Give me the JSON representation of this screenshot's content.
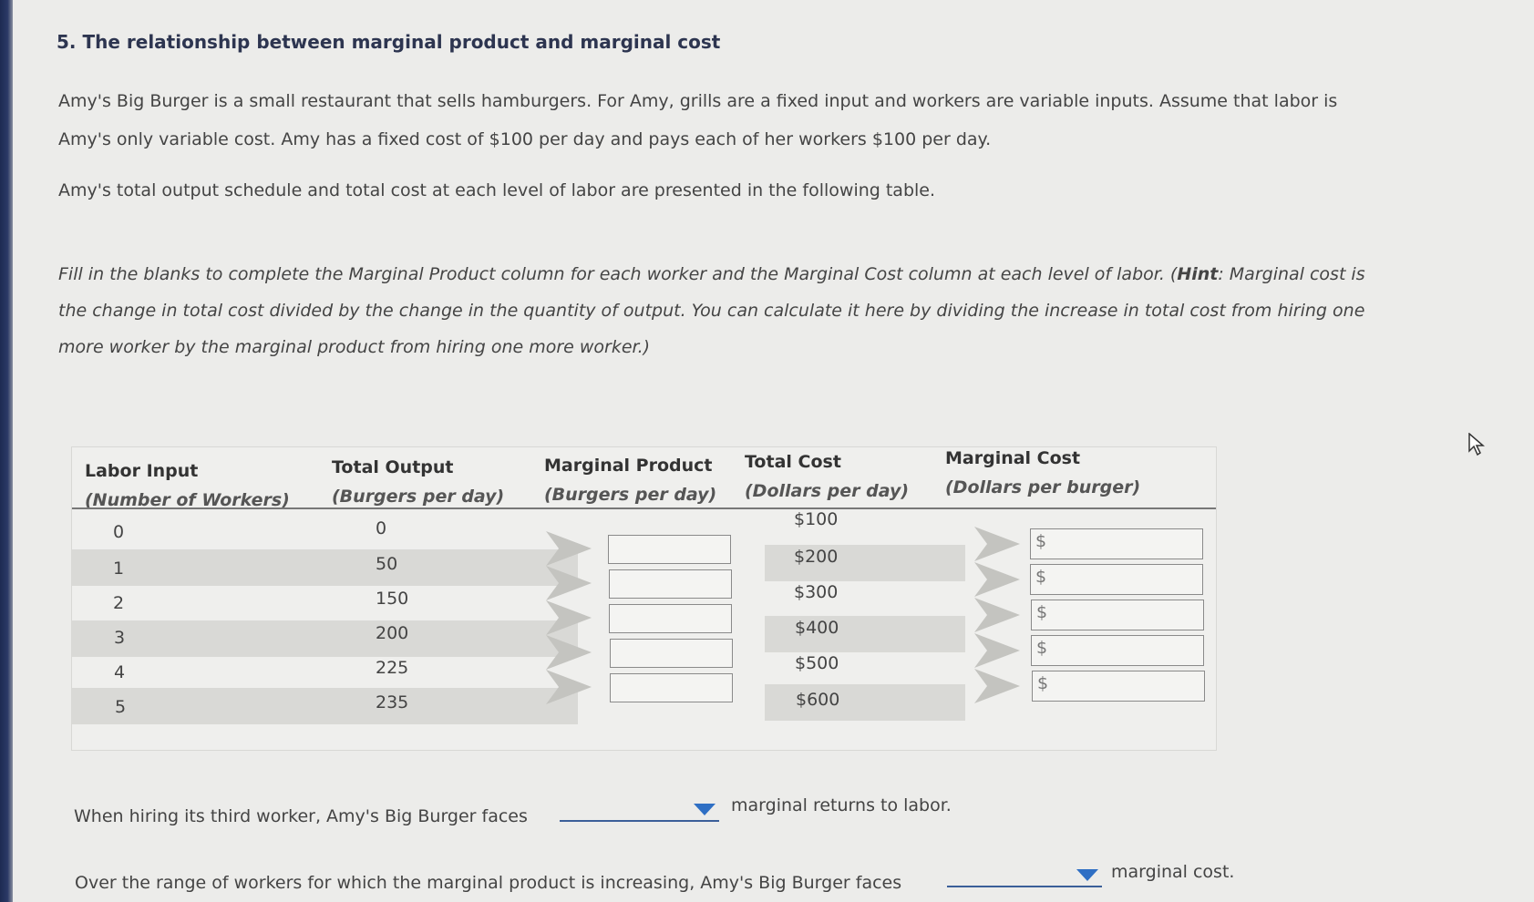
{
  "question": {
    "title": "5. The relationship between marginal product and marginal cost",
    "intro_line1": "Amy's Big Burger is a small restaurant that sells hamburgers. For Amy, grills are a fixed input and workers are variable inputs. Assume that labor is",
    "intro_line2": "Amy's only variable cost. Amy has a fixed cost of $100 per day and pays each of her workers $100 per day.",
    "intro_line3": "Amy's total output schedule and total cost at each level of labor are presented in the following table.",
    "instr_line1_a": "Fill in the blanks to complete the Marginal Product column for each worker and the Marginal Cost column at each level of labor. (",
    "instr_hint": "Hint",
    "instr_line1_b": ": Marginal cost is",
    "instr_line2": "the change in total cost divided by the change in the quantity of output. You can calculate it here by dividing the increase in total cost from hiring one",
    "instr_line3": "more worker by the marginal product from hiring one more worker.)"
  },
  "table": {
    "headers": [
      {
        "title": "Labor Input",
        "sub": "(Number of Workers)"
      },
      {
        "title": "Total Output",
        "sub": "(Burgers per day)"
      },
      {
        "title": "Marginal Product",
        "sub": "(Burgers per day)"
      },
      {
        "title": "Total Cost",
        "sub": "(Dollars per day)"
      },
      {
        "title": "Marginal Cost",
        "sub": "(Dollars per burger)"
      }
    ],
    "rows": [
      {
        "labor": "0",
        "output": "0",
        "total_cost": "$100"
      },
      {
        "labor": "1",
        "output": "50",
        "total_cost": "$200"
      },
      {
        "labor": "2",
        "output": "150",
        "total_cost": "$300"
      },
      {
        "labor": "3",
        "output": "200",
        "total_cost": "$400"
      },
      {
        "labor": "4",
        "output": "225",
        "total_cost": "$500"
      },
      {
        "labor": "5",
        "output": "235",
        "total_cost": "$600"
      }
    ],
    "marginal_product_inputs": [
      "",
      "",
      "",
      "",
      ""
    ],
    "marginal_cost_prefix": "$",
    "marginal_cost_inputs": [
      "",
      "",
      "",
      "",
      ""
    ]
  },
  "questions": {
    "q1_before": "When hiring its third worker, Amy's Big Burger faces",
    "q1_selected": "",
    "q1_after": "marginal returns to labor.",
    "q2_before": "Over the range of workers for which the marginal product is increasing, Amy's Big Burger faces",
    "q2_selected": "",
    "q2_after": "marginal cost."
  }
}
